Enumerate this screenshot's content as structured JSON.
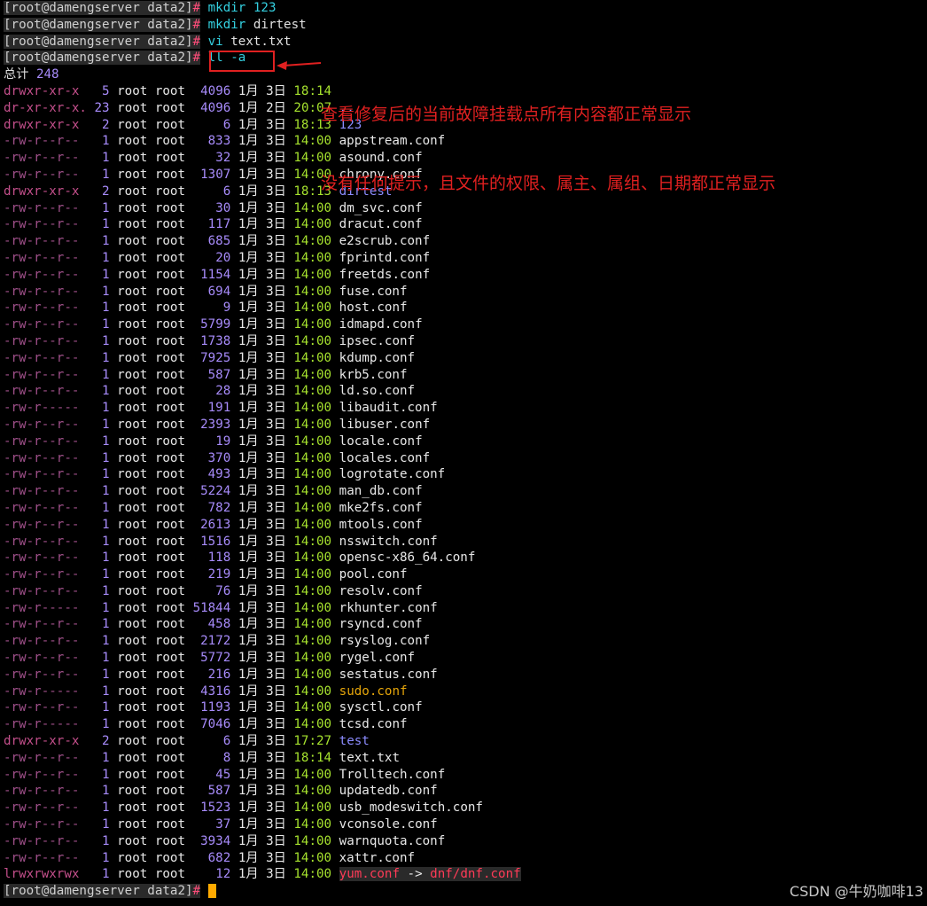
{
  "prompt": "[root@damengserver data2]",
  "hash": "#",
  "commands": [
    {
      "head": " mkdir",
      "arg": " 123",
      "arg_color": "cmd"
    },
    {
      "head": " mkdir",
      "arg": " dirtest",
      "arg_color": "cmd-w"
    },
    {
      "head": " vi",
      "arg": " text.txt",
      "arg_color": "cmd-w"
    },
    {
      "head": " ll",
      "arg": " -a",
      "arg_color": "cmd"
    }
  ],
  "total": {
    "label": "总计",
    "value": "248"
  },
  "annotation": {
    "line1": "查看修复后的当前故障挂载点所有内容都正常显示",
    "line2": "没有任何提示，且文件的权限、属主、属组、日期都正常显示",
    "color": "#e02020"
  },
  "watermark": "CSDN @牛奶咖啡13",
  "entries": [
    {
      "perm": "drwxr-xr-x",
      "links": "5",
      "owner": "root root",
      "size": "4096",
      "month": "1月",
      "day": "3日",
      "time": "18:14",
      "name": "",
      "kind": "d"
    },
    {
      "perm": "dr-xr-xr-x.",
      "links": "23",
      "owner": "root root",
      "size": "4096",
      "month": "1月",
      "day": "2日",
      "time": "20:07",
      "name": "..",
      "kind": "d"
    },
    {
      "perm": "drwxr-xr-x",
      "links": "2",
      "owner": "root root",
      "size": "6",
      "month": "1月",
      "day": "3日",
      "time": "18:13",
      "name": "123",
      "kind": "d"
    },
    {
      "perm": "-rw-r--r--",
      "links": "1",
      "owner": "root root",
      "size": "833",
      "month": "1月",
      "day": "3日",
      "time": "14:00",
      "name": "appstream.conf",
      "kind": "f"
    },
    {
      "perm": "-rw-r--r--",
      "links": "1",
      "owner": "root root",
      "size": "32",
      "month": "1月",
      "day": "3日",
      "time": "14:00",
      "name": "asound.conf",
      "kind": "f"
    },
    {
      "perm": "-rw-r--r--",
      "links": "1",
      "owner": "root root",
      "size": "1307",
      "month": "1月",
      "day": "3日",
      "time": "14:00",
      "name": "chrony.conf",
      "kind": "f"
    },
    {
      "perm": "drwxr-xr-x",
      "links": "2",
      "owner": "root root",
      "size": "6",
      "month": "1月",
      "day": "3日",
      "time": "18:13",
      "name": "dirtest",
      "kind": "d"
    },
    {
      "perm": "-rw-r--r--",
      "links": "1",
      "owner": "root root",
      "size": "30",
      "month": "1月",
      "day": "3日",
      "time": "14:00",
      "name": "dm_svc.conf",
      "kind": "f"
    },
    {
      "perm": "-rw-r--r--",
      "links": "1",
      "owner": "root root",
      "size": "117",
      "month": "1月",
      "day": "3日",
      "time": "14:00",
      "name": "dracut.conf",
      "kind": "f"
    },
    {
      "perm": "-rw-r--r--",
      "links": "1",
      "owner": "root root",
      "size": "685",
      "month": "1月",
      "day": "3日",
      "time": "14:00",
      "name": "e2scrub.conf",
      "kind": "f"
    },
    {
      "perm": "-rw-r--r--",
      "links": "1",
      "owner": "root root",
      "size": "20",
      "month": "1月",
      "day": "3日",
      "time": "14:00",
      "name": "fprintd.conf",
      "kind": "f"
    },
    {
      "perm": "-rw-r--r--",
      "links": "1",
      "owner": "root root",
      "size": "1154",
      "month": "1月",
      "day": "3日",
      "time": "14:00",
      "name": "freetds.conf",
      "kind": "f"
    },
    {
      "perm": "-rw-r--r--",
      "links": "1",
      "owner": "root root",
      "size": "694",
      "month": "1月",
      "day": "3日",
      "time": "14:00",
      "name": "fuse.conf",
      "kind": "f"
    },
    {
      "perm": "-rw-r--r--",
      "links": "1",
      "owner": "root root",
      "size": "9",
      "month": "1月",
      "day": "3日",
      "time": "14:00",
      "name": "host.conf",
      "kind": "f"
    },
    {
      "perm": "-rw-r--r--",
      "links": "1",
      "owner": "root root",
      "size": "5799",
      "month": "1月",
      "day": "3日",
      "time": "14:00",
      "name": "idmapd.conf",
      "kind": "f"
    },
    {
      "perm": "-rw-r--r--",
      "links": "1",
      "owner": "root root",
      "size": "1738",
      "month": "1月",
      "day": "3日",
      "time": "14:00",
      "name": "ipsec.conf",
      "kind": "f"
    },
    {
      "perm": "-rw-r--r--",
      "links": "1",
      "owner": "root root",
      "size": "7925",
      "month": "1月",
      "day": "3日",
      "time": "14:00",
      "name": "kdump.conf",
      "kind": "f"
    },
    {
      "perm": "-rw-r--r--",
      "links": "1",
      "owner": "root root",
      "size": "587",
      "month": "1月",
      "day": "3日",
      "time": "14:00",
      "name": "krb5.conf",
      "kind": "f"
    },
    {
      "perm": "-rw-r--r--",
      "links": "1",
      "owner": "root root",
      "size": "28",
      "month": "1月",
      "day": "3日",
      "time": "14:00",
      "name": "ld.so.conf",
      "kind": "f"
    },
    {
      "perm": "-rw-r-----",
      "links": "1",
      "owner": "root root",
      "size": "191",
      "month": "1月",
      "day": "3日",
      "time": "14:00",
      "name": "libaudit.conf",
      "kind": "f"
    },
    {
      "perm": "-rw-r--r--",
      "links": "1",
      "owner": "root root",
      "size": "2393",
      "month": "1月",
      "day": "3日",
      "time": "14:00",
      "name": "libuser.conf",
      "kind": "f"
    },
    {
      "perm": "-rw-r--r--",
      "links": "1",
      "owner": "root root",
      "size": "19",
      "month": "1月",
      "day": "3日",
      "time": "14:00",
      "name": "locale.conf",
      "kind": "f"
    },
    {
      "perm": "-rw-r--r--",
      "links": "1",
      "owner": "root root",
      "size": "370",
      "month": "1月",
      "day": "3日",
      "time": "14:00",
      "name": "locales.conf",
      "kind": "f"
    },
    {
      "perm": "-rw-r--r--",
      "links": "1",
      "owner": "root root",
      "size": "493",
      "month": "1月",
      "day": "3日",
      "time": "14:00",
      "name": "logrotate.conf",
      "kind": "f"
    },
    {
      "perm": "-rw-r--r--",
      "links": "1",
      "owner": "root root",
      "size": "5224",
      "month": "1月",
      "day": "3日",
      "time": "14:00",
      "name": "man_db.conf",
      "kind": "f"
    },
    {
      "perm": "-rw-r--r--",
      "links": "1",
      "owner": "root root",
      "size": "782",
      "month": "1月",
      "day": "3日",
      "time": "14:00",
      "name": "mke2fs.conf",
      "kind": "f"
    },
    {
      "perm": "-rw-r--r--",
      "links": "1",
      "owner": "root root",
      "size": "2613",
      "month": "1月",
      "day": "3日",
      "time": "14:00",
      "name": "mtools.conf",
      "kind": "f"
    },
    {
      "perm": "-rw-r--r--",
      "links": "1",
      "owner": "root root",
      "size": "1516",
      "month": "1月",
      "day": "3日",
      "time": "14:00",
      "name": "nsswitch.conf",
      "kind": "f"
    },
    {
      "perm": "-rw-r--r--",
      "links": "1",
      "owner": "root root",
      "size": "118",
      "month": "1月",
      "day": "3日",
      "time": "14:00",
      "name": "opensc-x86_64.conf",
      "kind": "f"
    },
    {
      "perm": "-rw-r--r--",
      "links": "1",
      "owner": "root root",
      "size": "219",
      "month": "1月",
      "day": "3日",
      "time": "14:00",
      "name": "pool.conf",
      "kind": "f"
    },
    {
      "perm": "-rw-r--r--",
      "links": "1",
      "owner": "root root",
      "size": "76",
      "month": "1月",
      "day": "3日",
      "time": "14:00",
      "name": "resolv.conf",
      "kind": "f"
    },
    {
      "perm": "-rw-r-----",
      "links": "1",
      "owner": "root root",
      "size": "51844",
      "month": "1月",
      "day": "3日",
      "time": "14:00",
      "name": "rkhunter.conf",
      "kind": "f"
    },
    {
      "perm": "-rw-r--r--",
      "links": "1",
      "owner": "root root",
      "size": "458",
      "month": "1月",
      "day": "3日",
      "time": "14:00",
      "name": "rsyncd.conf",
      "kind": "f"
    },
    {
      "perm": "-rw-r--r--",
      "links": "1",
      "owner": "root root",
      "size": "2172",
      "month": "1月",
      "day": "3日",
      "time": "14:00",
      "name": "rsyslog.conf",
      "kind": "f"
    },
    {
      "perm": "-rw-r--r--",
      "links": "1",
      "owner": "root root",
      "size": "5772",
      "month": "1月",
      "day": "3日",
      "time": "14:00",
      "name": "rygel.conf",
      "kind": "f"
    },
    {
      "perm": "-rw-r--r--",
      "links": "1",
      "owner": "root root",
      "size": "216",
      "month": "1月",
      "day": "3日",
      "time": "14:00",
      "name": "sestatus.conf",
      "kind": "f"
    },
    {
      "perm": "-rw-r-----",
      "links": "1",
      "owner": "root root",
      "size": "4316",
      "month": "1月",
      "day": "3日",
      "time": "14:00",
      "name": "sudo.conf",
      "kind": "s"
    },
    {
      "perm": "-rw-r--r--",
      "links": "1",
      "owner": "root root",
      "size": "1193",
      "month": "1月",
      "day": "3日",
      "time": "14:00",
      "name": "sysctl.conf",
      "kind": "f"
    },
    {
      "perm": "-rw-r-----",
      "links": "1",
      "owner": "root root",
      "size": "7046",
      "month": "1月",
      "day": "3日",
      "time": "14:00",
      "name": "tcsd.conf",
      "kind": "f"
    },
    {
      "perm": "drwxr-xr-x",
      "links": "2",
      "owner": "root root",
      "size": "6",
      "month": "1月",
      "day": "3日",
      "time": "17:27",
      "name": "test",
      "kind": "d"
    },
    {
      "perm": "-rw-r--r--",
      "links": "1",
      "owner": "root root",
      "size": "8",
      "month": "1月",
      "day": "3日",
      "time": "18:14",
      "name": "text.txt",
      "kind": "f"
    },
    {
      "perm": "-rw-r--r--",
      "links": "1",
      "owner": "root root",
      "size": "45",
      "month": "1月",
      "day": "3日",
      "time": "14:00",
      "name": "Trolltech.conf",
      "kind": "f"
    },
    {
      "perm": "-rw-r--r--",
      "links": "1",
      "owner": "root root",
      "size": "587",
      "month": "1月",
      "day": "3日",
      "time": "14:00",
      "name": "updatedb.conf",
      "kind": "f"
    },
    {
      "perm": "-rw-r--r--",
      "links": "1",
      "owner": "root root",
      "size": "1523",
      "month": "1月",
      "day": "3日",
      "time": "14:00",
      "name": "usb_modeswitch.conf",
      "kind": "f"
    },
    {
      "perm": "-rw-r--r--",
      "links": "1",
      "owner": "root root",
      "size": "37",
      "month": "1月",
      "day": "3日",
      "time": "14:00",
      "name": "vconsole.conf",
      "kind": "f"
    },
    {
      "perm": "-rw-r--r--",
      "links": "1",
      "owner": "root root",
      "size": "3934",
      "month": "1月",
      "day": "3日",
      "time": "14:00",
      "name": "warnquota.conf",
      "kind": "f"
    },
    {
      "perm": "-rw-r--r--",
      "links": "1",
      "owner": "root root",
      "size": "682",
      "month": "1月",
      "day": "3日",
      "time": "14:00",
      "name": "xattr.conf",
      "kind": "f"
    },
    {
      "perm": "lrwxrwxrwx",
      "links": "1",
      "owner": "root root",
      "size": "12",
      "month": "1月",
      "day": "3日",
      "time": "14:00",
      "name": "yum.conf",
      "link_arrow": " -> ",
      "link_target": "dnf/dnf.conf",
      "kind": "l"
    }
  ]
}
